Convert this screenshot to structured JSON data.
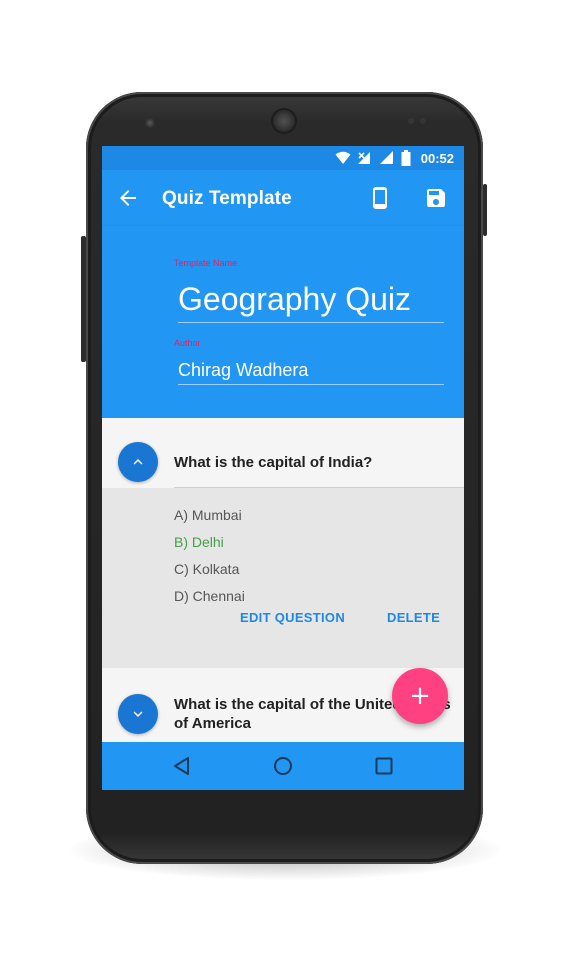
{
  "status_bar": {
    "time": "00:52",
    "icons": [
      "wifi-icon",
      "no-sim-signal-icon",
      "cell-signal-icon",
      "battery-icon"
    ]
  },
  "toolbar": {
    "title": "Quiz Template",
    "icons": [
      "back-arrow-icon",
      "phone-preview-icon",
      "save-icon"
    ]
  },
  "form": {
    "template_name_label": "Template Name",
    "template_name_value": "Geography Quiz",
    "author_label": "Author",
    "author_value": "Chirag Wadhera"
  },
  "questions": [
    {
      "text": "What is the capital of India?",
      "expanded": true,
      "answers": [
        "A) Mumbai",
        "B) Delhi",
        "C) Kolkata",
        "D) Chennai"
      ],
      "correct_index": 1,
      "edit_label": "EDIT QUESTION",
      "delete_label": "DELETE"
    },
    {
      "text": "What is the capital of the United States of America",
      "expanded": false
    }
  ],
  "fab": {
    "label": "+"
  },
  "nav_bar": {
    "icons": [
      "back-triangle-icon",
      "home-circle-icon",
      "recents-square-icon"
    ]
  },
  "colors": {
    "primary": "#2196f3",
    "primary_dark": "#1e88e5",
    "accent": "#ff4081",
    "correct": "#43a047",
    "label_pink": "#e91e63"
  }
}
